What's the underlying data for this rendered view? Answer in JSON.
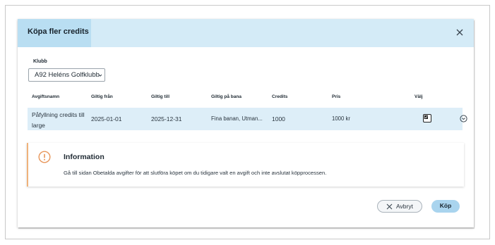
{
  "dialog": {
    "title": "Köpa fler credits"
  },
  "club": {
    "label": "Klubb",
    "selected": "A92 Heléns Golfklubb"
  },
  "table": {
    "headers": [
      "Avgiftsnamn",
      "Giltig från",
      "Giltig till",
      "Giltig på bana",
      "Credits",
      "Pris",
      "Välj"
    ],
    "rows": [
      {
        "name": "Påfyllning credits till large",
        "valid_from": "2025-01-01",
        "valid_to": "2025-12-31",
        "course": "Fina banan, Utman...",
        "credits": "1000",
        "price": "1000 kr",
        "selected": true
      }
    ]
  },
  "info": {
    "title": "Information",
    "text": "Gå till sidan Obetalda avgifter för att slutföra köpet om du tidigare valt en avgift och inte avslutat köpprocessen.",
    "accent": "#f0b27a"
  },
  "buttons": {
    "cancel": "Avbryt",
    "buy": "Köp"
  },
  "colors": {
    "header": "#d4ebf7",
    "header_tab": "#b9def2",
    "row": "#ddeef8",
    "buy": "#a9d4ee"
  }
}
